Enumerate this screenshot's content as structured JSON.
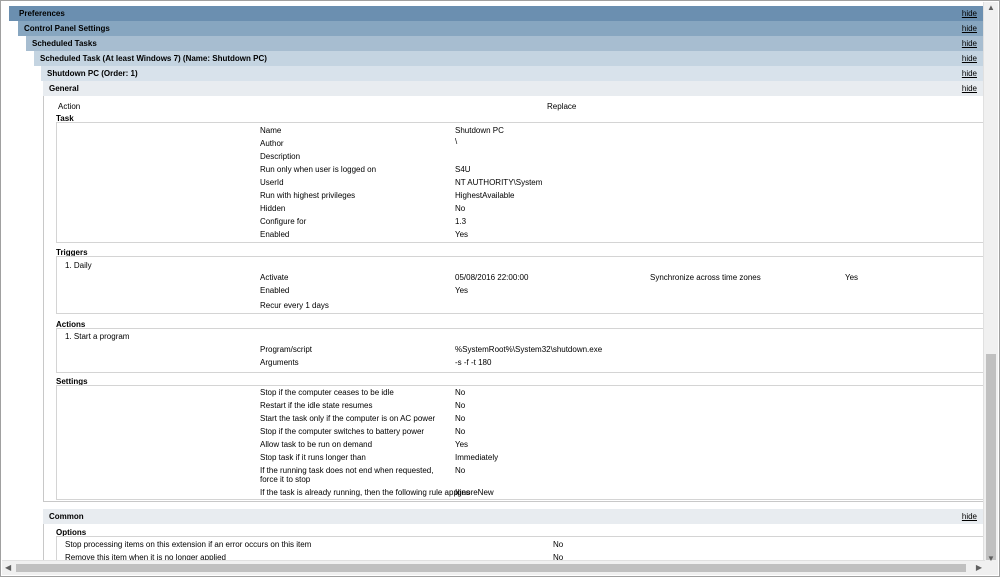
{
  "headers": {
    "preferences": "Preferences",
    "control_panel": "Control Panel Settings",
    "scheduled_tasks": "Scheduled Tasks",
    "scheduled_task": "Scheduled Task (At least Windows 7) (Name: Shutdown PC)",
    "shutdown_pc": "Shutdown PC (Order: 1)",
    "general": "General",
    "common": "Common",
    "hide": "hide"
  },
  "general": {
    "action_label": "Action",
    "action_value": "Replace"
  },
  "task": {
    "title": "Task",
    "rows": [
      {
        "label": "Name",
        "value": "Shutdown PC"
      },
      {
        "label": "Author",
        "value": "\\"
      },
      {
        "label": "Description",
        "value": ""
      },
      {
        "label": "Run only when user is logged on",
        "value": "S4U"
      },
      {
        "label": "UserId",
        "value": "NT AUTHORITY\\System"
      },
      {
        "label": "Run with highest privileges",
        "value": "HighestAvailable"
      },
      {
        "label": "Hidden",
        "value": "No"
      },
      {
        "label": "Configure for",
        "value": "1.3"
      },
      {
        "label": "Enabled",
        "value": "Yes"
      }
    ]
  },
  "triggers": {
    "title": "Triggers",
    "item": "1. Daily",
    "activate_label": "Activate",
    "activate_value": "05/08/2016 22:00:00",
    "sync_label": "Synchronize across time zones",
    "sync_value": "Yes",
    "enabled_label": "Enabled",
    "enabled_value": "Yes",
    "recur": "Recur every 1 days"
  },
  "actions": {
    "title": "Actions",
    "item": "1. Start a program",
    "program_label": "Program/script",
    "program_value": "%SystemRoot%\\System32\\shutdown.exe",
    "args_label": "Arguments",
    "args_value": "-s -f -t 180"
  },
  "settings": {
    "title": "Settings",
    "rows": [
      {
        "label": "Stop if the computer ceases to be idle",
        "value": "No"
      },
      {
        "label": "Restart if the idle state resumes",
        "value": "No"
      },
      {
        "label": "Start the task only if the computer is on AC power",
        "value": "No"
      },
      {
        "label": "Stop if the computer switches to battery power",
        "value": "No"
      },
      {
        "label": "Allow task to be run on demand",
        "value": "Yes"
      },
      {
        "label": "Stop task if it runs longer than",
        "value": "Immediately"
      },
      {
        "label": "If the running task does not end when requested, force it to stop",
        "value": "No"
      },
      {
        "label": "If the task is already running, then the following rule applies",
        "value": "IgnoreNew"
      }
    ]
  },
  "options": {
    "title": "Options",
    "rows": [
      {
        "label": "Stop processing items on this extension if an error occurs on this item",
        "value": "No"
      },
      {
        "label": "Remove this item when it is no longer applied",
        "value": "No"
      }
    ]
  },
  "scrollbar": {
    "up_arrow": "▲",
    "down_arrow": "▼",
    "left_arrow": "◀",
    "right_arrow": "▶"
  }
}
